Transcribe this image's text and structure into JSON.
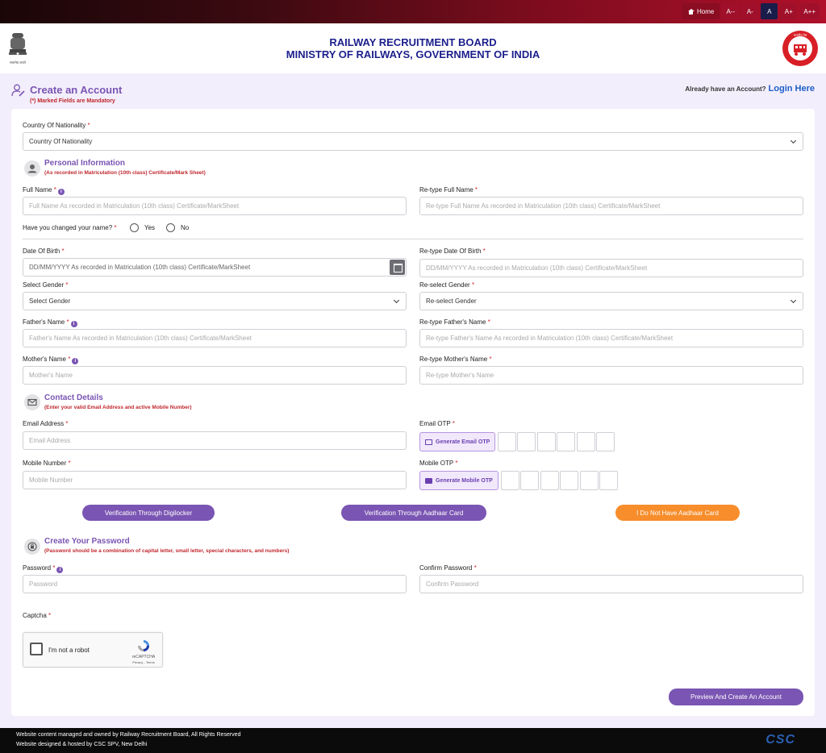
{
  "topnav": {
    "home": "Home",
    "font_sizes": [
      "A--",
      "A-",
      "A",
      "A+",
      "A++"
    ]
  },
  "header": {
    "line1": "RAILWAY RECRUITMENT BOARD",
    "line2": "MINISTRY OF RAILWAYS, GOVERNMENT OF INDIA",
    "emblem_caption": "सत्यमेव जयते",
    "logo_text": "भारतीय रेल"
  },
  "account": {
    "title": "Create an Account",
    "mandatory_note": "(*) Marked Fields are Mandatory",
    "already_text": "Already have an Account?",
    "login_link": "Login Here"
  },
  "nationality": {
    "label": "Country Of Nationality",
    "value": "Country Of Nationality"
  },
  "personal": {
    "title": "Personal Information",
    "note": "(As recorded in Matriculation (10th class) Certificate/Mark Sheet)",
    "full_name_label": "Full Name",
    "full_name_placeholder": "Full Name As recorded in Matriculation (10th class)  Certificate/MarkSheet",
    "retype_full_name_label": "Re-type Full Name",
    "retype_full_name_placeholder": "Re-type Full Name As recorded in Matriculation (10th class)  Certificate/MarkSheet",
    "changed_name_label": "Have you changed your name?",
    "yes": "Yes",
    "no": "No",
    "dob_label": "Date Of Birth",
    "dob_placeholder": "DD/MM/YYYY As recorded in Matriculation (10th class)  Certificate/MarkSheet",
    "retype_dob_label": "Re-type Date Of Birth",
    "retype_dob_placeholder": "DD/MM/YYYY As recorded in Matriculation (10th class)  Certificate/MarkSheet",
    "gender_label": "Select Gender",
    "gender_value": "Select Gender",
    "regender_label": "Re-select Gender",
    "regender_value": "Re-select Gender",
    "father_label": "Father's Name",
    "father_placeholder": "Father's Name As recorded in Matriculation (10th class)  Certificate/MarkSheet",
    "retype_father_label": "Re-type Father's Name",
    "retype_father_placeholder": "Re-type Father's Name As recorded in Matriculation (10th class)  Certificate/MarkSheet",
    "mother_label": "Mother's Name",
    "mother_placeholder": "Mother's Name",
    "retype_mother_label": "Re-type Mother's Name",
    "retype_mother_placeholder": "Re-type Mother's Name"
  },
  "contact": {
    "title": "Contact Details",
    "note": "(Enter your valid Email Address and active Mobile Number)",
    "email_label": "Email Address",
    "email_placeholder": "Email Address",
    "email_otp_label": "Email OTP",
    "gen_email_otp": "Generate Email OTP",
    "mobile_label": "Mobile Number",
    "mobile_placeholder": "Mobile Number",
    "mobile_otp_label": "Mobile OTP",
    "gen_mobile_otp": "Generate Mobile OTP"
  },
  "verification": {
    "digilocker": "Verification Through Digilocker",
    "aadhaar": "Verification Through Aadhaar Card",
    "no_aadhaar": "I Do Not Have Aadhaar Card"
  },
  "password": {
    "title": "Create Your Password",
    "note": "(Password should be a combination of capital letter, small letter, special characters, and numbers)",
    "password_label": "Password",
    "password_placeholder": "Password",
    "confirm_label": "Confirm Password",
    "confirm_placeholder": "Confirm Password"
  },
  "captcha": {
    "label": "Captcha",
    "checkbox_text": "I'm not a robot",
    "brand": "reCAPTCHA",
    "terms": "Privacy - Terms"
  },
  "submit": "Preview And Create An Account",
  "footer": {
    "line1": "Website content managed and owned by Railway Recruitment Board, All Rights Reserved",
    "line2": "Website designed & hosted by CSC SPV, New Delhi",
    "logo": "CSC"
  },
  "colors": {
    "accent": "#7a55b3",
    "orange": "#f78d2b",
    "header_blue": "#1c1f8c",
    "required": "#d32a2a"
  }
}
